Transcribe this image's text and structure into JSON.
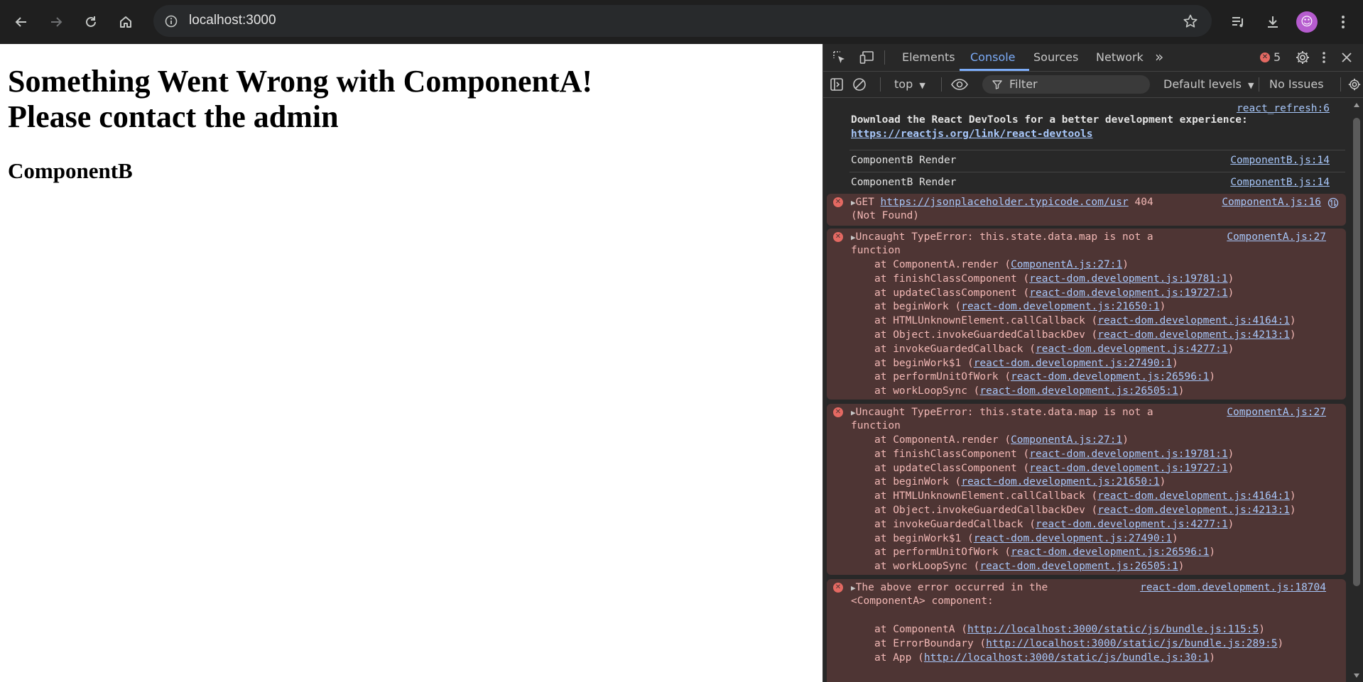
{
  "browser": {
    "url": "localhost:3000",
    "avatar_glyph": "☺"
  },
  "page": {
    "heading_line1": "Something Went Wrong with ComponentA!",
    "heading_line2": "Please contact the admin",
    "subheading": "ComponentB"
  },
  "devtools": {
    "tabs": [
      "Elements",
      "Console",
      "Sources",
      "Network"
    ],
    "active_tab": "Console",
    "more_tabs": "»",
    "error_count": "5",
    "toolbar": {
      "context": "top",
      "filter_placeholder": "Filter",
      "levels": "Default levels",
      "issues": "No Issues"
    },
    "console": {
      "messages": [
        {
          "source": "react_refresh:6",
          "line1": "Download the React DevTools for a better development experience:",
          "link": "https://reactjs.org/link/react-devtools"
        },
        {
          "text": "ComponentB Render",
          "source": "ComponentB.js:14"
        },
        {
          "text": "ComponentB Render",
          "source": "ComponentB.js:14"
        },
        {
          "prefix": "GET ",
          "link": "https://jsonplaceholder.typicode.com/usr",
          "suffix": " 404",
          "line2": "(Not Found)",
          "source": "ComponentA.js:16"
        },
        {
          "line1": "Uncaught TypeError: this.state.data.map is not a",
          "line2": "function",
          "source": "ComponentA.js:27"
        },
        {
          "line1": "Uncaught TypeError: this.state.data.map is not a",
          "line2": "function",
          "source": "ComponentA.js:27"
        },
        {
          "line1": "The above error occurred in the",
          "line2": "<ComponentA> component:",
          "source": "react-dom.development.js:18704"
        }
      ],
      "stack_trace": [
        {
          "fn": "ComponentA.render",
          "loc": "ComponentA.js:27:1"
        },
        {
          "fn": "finishClassComponent",
          "loc": "react-dom.development.js:19781:1"
        },
        {
          "fn": "updateClassComponent",
          "loc": "react-dom.development.js:19727:1"
        },
        {
          "fn": "beginWork",
          "loc": "react-dom.development.js:21650:1"
        },
        {
          "fn": "HTMLUnknownElement.callCallback",
          "loc": "react-dom.development.js:4164:1"
        },
        {
          "fn": "Object.invokeGuardedCallbackDev",
          "loc": "react-dom.development.js:4213:1"
        },
        {
          "fn": "invokeGuardedCallback",
          "loc": "react-dom.development.js:4277:1"
        },
        {
          "fn": "beginWork$1",
          "loc": "react-dom.development.js:27490:1"
        },
        {
          "fn": "performUnitOfWork",
          "loc": "react-dom.development.js:26596:1"
        },
        {
          "fn": "workLoopSync",
          "loc": "react-dom.development.js:26505:1"
        }
      ],
      "component_stack": [
        {
          "fn": "ComponentA",
          "loc": "http://localhost:3000/static/js/bundle.js:115:5"
        },
        {
          "fn": "ErrorBoundary",
          "loc": "http://localhost:3000/static/js/bundle.js:289:5"
        },
        {
          "fn": "App",
          "loc": "http://localhost:3000/static/js/bundle.js:30:1"
        }
      ]
    }
  }
}
